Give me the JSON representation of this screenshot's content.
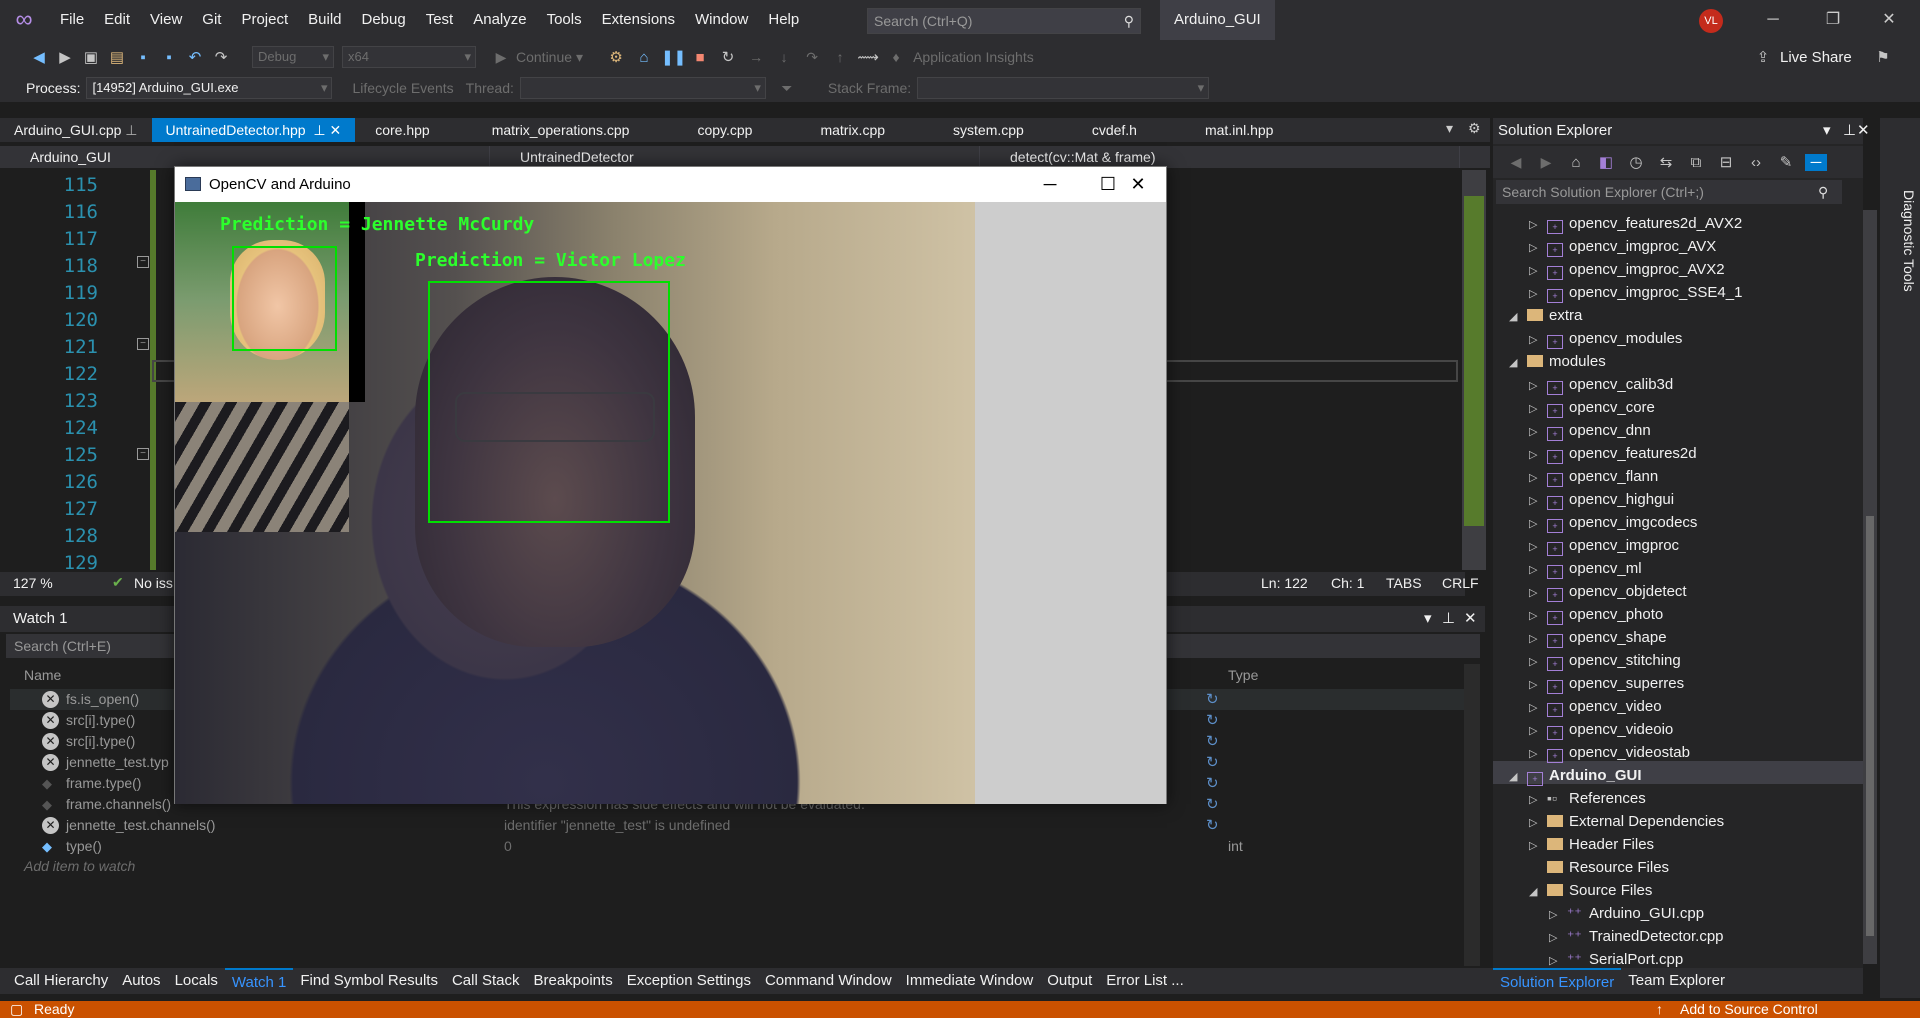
{
  "menu": [
    "File",
    "Edit",
    "View",
    "Git",
    "Project",
    "Build",
    "Debug",
    "Test",
    "Analyze",
    "Tools",
    "Extensions",
    "Window",
    "Help"
  ],
  "search": {
    "placeholder": "Search (Ctrl+Q)"
  },
  "solution_name": "Arduino_GUI",
  "user_initials": "VL",
  "toolbar": {
    "config": "Debug",
    "platform": "x64",
    "continue": "Continue",
    "app_insights": "Application Insights",
    "live_share": "Live Share"
  },
  "debugbar": {
    "process_label": "Process:",
    "process_value": "[14952] Arduino_GUI.exe",
    "lifecycle": "Lifecycle Events",
    "thread_label": "Thread:",
    "stack_label": "Stack Frame:"
  },
  "doc_tabs": [
    {
      "label": "Arduino_GUI.cpp",
      "active": false
    },
    {
      "label": "UntrainedDetector.hpp",
      "active": true
    },
    {
      "label": "core.hpp",
      "active": false
    },
    {
      "label": "matrix_operations.cpp",
      "active": false
    },
    {
      "label": "copy.cpp",
      "active": false
    },
    {
      "label": "matrix.cpp",
      "active": false
    },
    {
      "label": "system.cpp",
      "active": false
    },
    {
      "label": "cvdef.h",
      "active": false
    },
    {
      "label": "mat.inl.hpp",
      "active": false
    }
  ],
  "navbar": {
    "project": "Arduino_GUI",
    "scope": "UntrainedDetector",
    "member": "detect(cv::Mat & frame)"
  },
  "line_numbers": [
    "115",
    "116",
    "117",
    "118",
    "119",
    "120",
    "121",
    "122",
    "123",
    "124",
    "125",
    "126",
    "127",
    "128",
    "129"
  ],
  "editor_status": {
    "zoom": "127 %",
    "issues": "No iss",
    "ln": "Ln: 122",
    "ch": "Ch: 1",
    "tabs": "TABS",
    "eol": "CRLF"
  },
  "watch": {
    "title": "Watch 1",
    "search_placeholder": "Search (Ctrl+E)",
    "col_name": "Name",
    "col_type": "Type",
    "rows": [
      {
        "name": "fs.is_open()",
        "value": "",
        "type": "",
        "icon": "error"
      },
      {
        "name": "src[i].type()",
        "value": "",
        "type": "",
        "icon": "error"
      },
      {
        "name": "src[i].type()",
        "value": "",
        "type": "",
        "icon": "error"
      },
      {
        "name": "jennette_test.typ",
        "value": "",
        "type": "",
        "icon": "error"
      },
      {
        "name": "frame.type()",
        "value": "",
        "type": "",
        "icon": "none"
      },
      {
        "name": "frame.channels()",
        "value": "This expression has side effects and will not be evaluated.",
        "type": "",
        "icon": "none"
      },
      {
        "name": "jennette_test.channels()",
        "value": "identifier \"jennette_test\" is undefined",
        "type": "",
        "icon": "error"
      },
      {
        "name": "type()",
        "value": "0",
        "type": "int",
        "icon": "value"
      }
    ],
    "add_item": "Add item to watch"
  },
  "bottom_tabs": [
    "Call Hierarchy",
    "Autos",
    "Locals",
    "Watch 1",
    "Find Symbol Results",
    "Call Stack",
    "Breakpoints",
    "Exception Settings",
    "Command Window",
    "Immediate Window",
    "Output",
    "Error List ..."
  ],
  "bottom_tab_active": "Watch 1",
  "status": {
    "ready": "Ready",
    "source_control": "Add to Source Control"
  },
  "solution_explorer": {
    "title": "Solution Explorer",
    "search_placeholder": "Search Solution Explorer (Ctrl+;)",
    "tree": [
      {
        "label": "opencv_features2d_AVX2",
        "level": 1,
        "kind": "project",
        "expander": "collapsed"
      },
      {
        "label": "opencv_imgproc_AVX",
        "level": 1,
        "kind": "project",
        "expander": "collapsed"
      },
      {
        "label": "opencv_imgproc_AVX2",
        "level": 1,
        "kind": "project",
        "expander": "collapsed"
      },
      {
        "label": "opencv_imgproc_SSE4_1",
        "level": 1,
        "kind": "project",
        "expander": "collapsed"
      },
      {
        "label": "extra",
        "level": 0,
        "kind": "folder",
        "expander": "expanded"
      },
      {
        "label": "opencv_modules",
        "level": 1,
        "kind": "project",
        "expander": "collapsed"
      },
      {
        "label": "modules",
        "level": 0,
        "kind": "folder",
        "expander": "expanded"
      },
      {
        "label": "opencv_calib3d",
        "level": 1,
        "kind": "project",
        "expander": "collapsed"
      },
      {
        "label": "opencv_core",
        "level": 1,
        "kind": "project",
        "expander": "collapsed"
      },
      {
        "label": "opencv_dnn",
        "level": 1,
        "kind": "project",
        "expander": "collapsed"
      },
      {
        "label": "opencv_features2d",
        "level": 1,
        "kind": "project",
        "expander": "collapsed"
      },
      {
        "label": "opencv_flann",
        "level": 1,
        "kind": "project",
        "expander": "collapsed"
      },
      {
        "label": "opencv_highgui",
        "level": 1,
        "kind": "project",
        "expander": "collapsed"
      },
      {
        "label": "opencv_imgcodecs",
        "level": 1,
        "kind": "project",
        "expander": "collapsed"
      },
      {
        "label": "opencv_imgproc",
        "level": 1,
        "kind": "project",
        "expander": "collapsed"
      },
      {
        "label": "opencv_ml",
        "level": 1,
        "kind": "project",
        "expander": "collapsed"
      },
      {
        "label": "opencv_objdetect",
        "level": 1,
        "kind": "project",
        "expander": "collapsed"
      },
      {
        "label": "opencv_photo",
        "level": 1,
        "kind": "project",
        "expander": "collapsed"
      },
      {
        "label": "opencv_shape",
        "level": 1,
        "kind": "project",
        "expander": "collapsed"
      },
      {
        "label": "opencv_stitching",
        "level": 1,
        "kind": "project",
        "expander": "collapsed"
      },
      {
        "label": "opencv_superres",
        "level": 1,
        "kind": "project",
        "expander": "collapsed"
      },
      {
        "label": "opencv_video",
        "level": 1,
        "kind": "project",
        "expander": "collapsed"
      },
      {
        "label": "opencv_videoio",
        "level": 1,
        "kind": "project",
        "expander": "collapsed"
      },
      {
        "label": "opencv_videostab",
        "level": 1,
        "kind": "project",
        "expander": "collapsed"
      },
      {
        "label": "Arduino_GUI",
        "level": 0,
        "kind": "project",
        "expander": "expanded",
        "bold": true
      },
      {
        "label": "References",
        "level": 1,
        "kind": "refs",
        "expander": "collapsed"
      },
      {
        "label": "External Dependencies",
        "level": 1,
        "kind": "folder",
        "expander": "collapsed"
      },
      {
        "label": "Header Files",
        "level": 1,
        "kind": "folder",
        "expander": "collapsed"
      },
      {
        "label": "Resource Files",
        "level": 1,
        "kind": "folder",
        "expander": "none"
      },
      {
        "label": "Source Files",
        "level": 1,
        "kind": "folder",
        "expander": "expanded"
      },
      {
        "label": "Arduino_GUI.cpp",
        "level": 2,
        "kind": "cpp",
        "expander": "collapsed"
      },
      {
        "label": "TrainedDetector.cpp",
        "level": 2,
        "kind": "cpp",
        "expander": "collapsed"
      },
      {
        "label": "SerialPort.cpp",
        "level": 2,
        "kind": "cpp",
        "expander": "collapsed"
      }
    ],
    "tabs": [
      "Solution Explorer",
      "Team Explorer"
    ]
  },
  "diagnostic_tools": "Diagnostic Tools",
  "opencv_window": {
    "title": "OpenCV and Arduino",
    "prediction_1": "Prediction = Jennette McCurdy",
    "prediction_2": "Prediction = Victor Lopez"
  },
  "colors": {
    "accent": "#007acc",
    "status_bar": "#ca5100",
    "detection": "#00e000"
  }
}
